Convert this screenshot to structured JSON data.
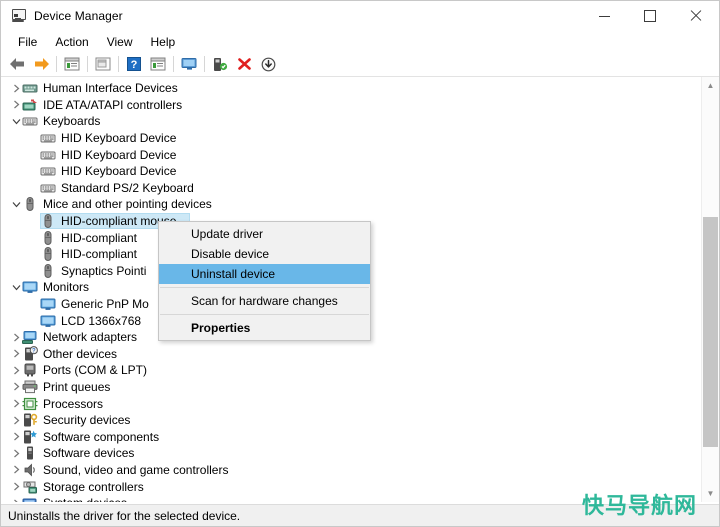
{
  "window": {
    "title": "Device Manager",
    "app_icon": "device-manager-icon",
    "buttons": {
      "minimize": "minimize",
      "maximize": "maximize",
      "close": "close"
    }
  },
  "menubar": {
    "items": [
      "File",
      "Action",
      "View",
      "Help"
    ]
  },
  "toolbar": {
    "items": [
      {
        "name": "back-icon",
        "glyph": "back"
      },
      {
        "name": "forward-icon",
        "glyph": "forward"
      },
      {
        "name": "separator",
        "glyph": "sep"
      },
      {
        "name": "show-hidden-devices-icon",
        "glyph": "list"
      },
      {
        "name": "separator",
        "glyph": "sep"
      },
      {
        "name": "properties-icon",
        "glyph": "props"
      },
      {
        "name": "separator",
        "glyph": "sep"
      },
      {
        "name": "help-icon",
        "glyph": "help"
      },
      {
        "name": "device-list-icon",
        "glyph": "list2"
      },
      {
        "name": "separator",
        "glyph": "sep"
      },
      {
        "name": "scan-hardware-changes-icon",
        "glyph": "monitor"
      },
      {
        "name": "separator",
        "glyph": "sep"
      },
      {
        "name": "update-driver-icon",
        "glyph": "update"
      },
      {
        "name": "uninstall-device-icon",
        "glyph": "uninstall"
      },
      {
        "name": "disable-device-icon",
        "glyph": "disable"
      }
    ]
  },
  "tree": {
    "rows": [
      {
        "label": "Human Interface Devices",
        "depth": 1,
        "expander": "collapsed",
        "icon": "hid-icon"
      },
      {
        "label": "IDE ATA/ATAPI controllers",
        "depth": 1,
        "expander": "collapsed",
        "icon": "ide-controller-icon"
      },
      {
        "label": "Keyboards",
        "depth": 1,
        "expander": "expanded",
        "icon": "keyboard-icon"
      },
      {
        "label": "HID Keyboard Device",
        "depth": 2,
        "expander": "none",
        "icon": "keyboard-icon"
      },
      {
        "label": "HID Keyboard Device",
        "depth": 2,
        "expander": "none",
        "icon": "keyboard-icon"
      },
      {
        "label": "HID Keyboard Device",
        "depth": 2,
        "expander": "none",
        "icon": "keyboard-icon"
      },
      {
        "label": "Standard PS/2 Keyboard",
        "depth": 2,
        "expander": "none",
        "icon": "keyboard-icon"
      },
      {
        "label": "Mice and other pointing devices",
        "depth": 1,
        "expander": "expanded",
        "icon": "mouse-icon"
      },
      {
        "label": "HID-compliant mouse",
        "depth": 2,
        "expander": "none",
        "icon": "mouse-icon",
        "selected": true
      },
      {
        "label": "HID-compliant",
        "depth": 2,
        "expander": "none",
        "icon": "mouse-icon"
      },
      {
        "label": "HID-compliant",
        "depth": 2,
        "expander": "none",
        "icon": "mouse-icon"
      },
      {
        "label": "Synaptics Pointi",
        "depth": 2,
        "expander": "none",
        "icon": "mouse-icon"
      },
      {
        "label": "Monitors",
        "depth": 1,
        "expander": "expanded",
        "icon": "monitor-icon"
      },
      {
        "label": "Generic PnP Mo",
        "depth": 2,
        "expander": "none",
        "icon": "monitor-icon"
      },
      {
        "label": "LCD 1366x768",
        "depth": 2,
        "expander": "none",
        "icon": "monitor-icon"
      },
      {
        "label": "Network adapters",
        "depth": 1,
        "expander": "collapsed",
        "icon": "network-adapter-icon"
      },
      {
        "label": "Other devices",
        "depth": 1,
        "expander": "collapsed",
        "icon": "other-device-icon"
      },
      {
        "label": "Ports (COM & LPT)",
        "depth": 1,
        "expander": "collapsed",
        "icon": "port-icon"
      },
      {
        "label": "Print queues",
        "depth": 1,
        "expander": "collapsed",
        "icon": "printer-icon"
      },
      {
        "label": "Processors",
        "depth": 1,
        "expander": "collapsed",
        "icon": "processor-icon"
      },
      {
        "label": "Security devices",
        "depth": 1,
        "expander": "collapsed",
        "icon": "security-device-icon"
      },
      {
        "label": "Software components",
        "depth": 1,
        "expander": "collapsed",
        "icon": "software-component-icon"
      },
      {
        "label": "Software devices",
        "depth": 1,
        "expander": "collapsed",
        "icon": "software-device-icon"
      },
      {
        "label": "Sound, video and game controllers",
        "depth": 1,
        "expander": "collapsed",
        "icon": "sound-controller-icon"
      },
      {
        "label": "Storage controllers",
        "depth": 1,
        "expander": "collapsed",
        "icon": "storage-controller-icon"
      },
      {
        "label": "System devices",
        "depth": 1,
        "expander": "collapsed",
        "icon": "system-device-icon"
      }
    ]
  },
  "context_menu": {
    "items": [
      {
        "label": "Update driver",
        "type": "item"
      },
      {
        "label": "Disable device",
        "type": "item"
      },
      {
        "label": "Uninstall device",
        "type": "item",
        "highlighted": true
      },
      {
        "type": "separator"
      },
      {
        "label": "Scan for hardware changes",
        "type": "item"
      },
      {
        "type": "separator"
      },
      {
        "label": "Properties",
        "type": "item",
        "bold": true
      }
    ]
  },
  "statusbar": {
    "text": "Uninstalls the driver for the selected device."
  },
  "watermark": {
    "text": "快马导航网",
    "color": "#2fb89a"
  },
  "scrollbar": {
    "up_arrow": "▲",
    "down_arrow": "▼"
  }
}
